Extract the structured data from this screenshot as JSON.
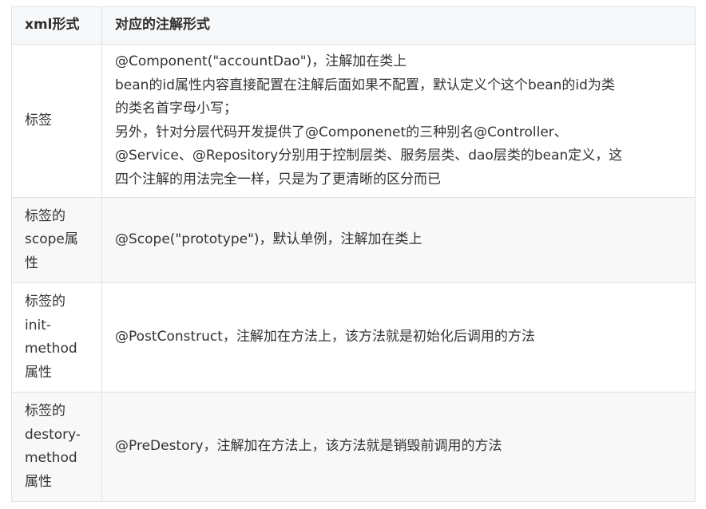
{
  "table": {
    "headers": [
      "xml形式",
      "对应的注解形式"
    ],
    "rows": [
      {
        "label_lines": [
          "标签"
        ],
        "content_lines": [
          "@Component(\"accountDao\")，注解加在类上",
          "bean的id属性内容直接配置在注解后面如果不配置，默认定义个这个bean的id为类",
          "的类名首字母小写；",
          "另外，针对分层代码开发提供了@Componenet的三种别名@Controller、",
          "@Service、@Repository分别用于控制层类、服务层类、dao层类的bean定义，这",
          "四个注解的用法完全一样，只是为了更清晰的区分而已"
        ]
      },
      {
        "label_lines": [
          "标签的",
          "scope属",
          "性"
        ],
        "content_lines": [
          "@Scope(\"prototype\")，默认单例，注解加在类上"
        ]
      },
      {
        "label_lines": [
          "标签的",
          "init-",
          "method",
          "属性"
        ],
        "content_lines": [
          "@PostConstruct，注解加在方法上，该方法就是初始化后调用的方法"
        ]
      },
      {
        "label_lines": [
          "标签的",
          "destory-",
          "method",
          "属性"
        ],
        "content_lines": [
          "@PreDestory，注解加在方法上，该方法就是销毁前调用的方法"
        ]
      }
    ]
  }
}
